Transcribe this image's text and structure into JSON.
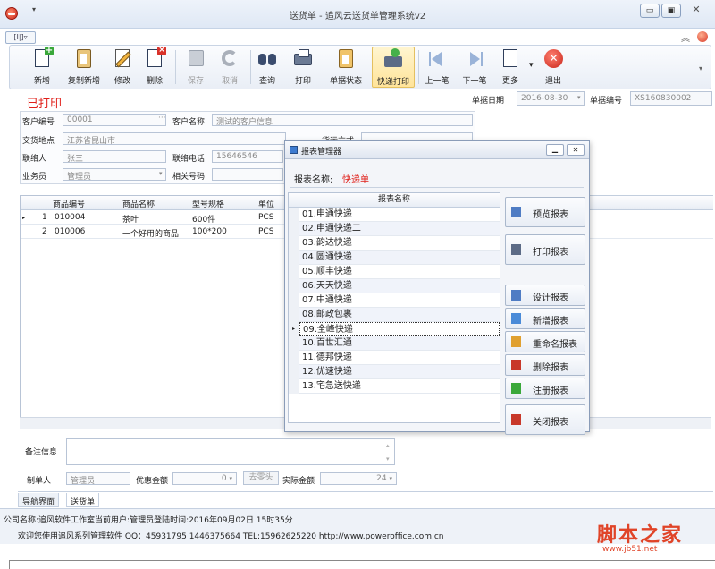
{
  "window": {
    "title": "送货单 - 追风云送货单管理系统v2",
    "min": "▭",
    "max": "▣",
    "close": "✕"
  },
  "ribbon_tab_toggle": "[I|]▿",
  "toolbar": {
    "buttons": [
      {
        "label": "新增",
        "icon": "new-doc-icon"
      },
      {
        "label": "复制新增",
        "icon": "copy-icon"
      },
      {
        "label": "修改",
        "icon": "edit-icon"
      },
      {
        "label": "删除",
        "icon": "delete-icon"
      },
      {
        "label": "保存",
        "icon": "save-icon",
        "disabled": true
      },
      {
        "label": "取消",
        "icon": "cancel-icon",
        "disabled": true
      },
      {
        "label": "查询",
        "icon": "binoculars-icon"
      },
      {
        "label": "打印",
        "icon": "print-icon"
      },
      {
        "label": "单据状态",
        "icon": "status-icon"
      },
      {
        "label": "快递打印",
        "icon": "express-print-icon",
        "active": true
      },
      {
        "label": "上一笔",
        "icon": "previous-icon"
      },
      {
        "label": "下一笔",
        "icon": "next-icon"
      },
      {
        "label": "更多",
        "icon": "more-icon"
      },
      {
        "label": "退出",
        "icon": "exit-icon"
      }
    ]
  },
  "doc": {
    "status": "已打印",
    "date_label": "单据日期",
    "date": "2016-08-30",
    "no_label": "单据编号",
    "no": "XS160830002"
  },
  "form": {
    "customer_no_label": "客户编号",
    "customer_no": "00001",
    "customer_name_label": "客户名称",
    "customer_name": "测试的客户信息",
    "delivery_label": "交货地点",
    "delivery": "江苏省昆山市",
    "contact_label": "联络人",
    "contact": "张三",
    "phone_label": "联络电话",
    "phone": "15646546",
    "salesman_label": "业务员",
    "salesman": "管理员",
    "related_no_label": "相关号码",
    "ship_label": "货运方式"
  },
  "grid": {
    "headers": [
      "商品编号",
      "商品名称",
      "型号规格",
      "单位"
    ],
    "rows": [
      {
        "idx": "1",
        "code": "010004",
        "name": "茶叶",
        "spec": "600件",
        "unit": "PCS"
      },
      {
        "idx": "2",
        "code": "010006",
        "name": "一个好用的商品",
        "spec": "100*200",
        "unit": "PCS"
      }
    ]
  },
  "footer": {
    "memo_label": "备注信息",
    "maker_label": "制单人",
    "maker": "管理员",
    "discount_label": "优惠金额",
    "discount": "0",
    "round_btn": "去零头",
    "actual_label": "实际金额",
    "actual": "24"
  },
  "tabs": [
    "导航界面",
    "送货单"
  ],
  "statusbar": {
    "line1": "公司名称:追风软件工作室当前用户:管理员登陆时间:2016年09月02日 15时35分",
    "line2": "欢迎您使用追风系列管理软件 QQ：45931795 1446375664 TEL:15962625220 http://www.poweroffice.com.cn"
  },
  "watermark": {
    "text": "脚本之家",
    "url": "www.jb51.net"
  },
  "dialog": {
    "title": "报表管理器",
    "min": "▁",
    "close": "✕",
    "report_label": "报表名称:",
    "report_value": "快递单",
    "list_header": "报表名称",
    "reports": [
      "01.申通快递",
      "02.申通快递二",
      "03.韵达快递",
      "04.圆通快递",
      "05.顺丰快递",
      "06.天天快递",
      "07.中通快递",
      "08.邮政包裹",
      "09.全峰快递",
      "10.百世汇通",
      "11.德邦快递",
      "12.优速快递",
      "13.宅急送快递"
    ],
    "selected_index": 8,
    "buttons": [
      {
        "label": "预览报表",
        "icon": "preview-icon",
        "color": "#4f7cc4"
      },
      {
        "label": "打印报表",
        "icon": "print-icon",
        "color": "#5c6b86"
      },
      {
        "label": "设计报表",
        "icon": "design-icon",
        "color": "#4f7cc4"
      },
      {
        "label": "新增报表",
        "icon": "add-report-icon",
        "color": "#4a8bd8"
      },
      {
        "label": "重命名报表",
        "icon": "rename-icon",
        "color": "#e0a030"
      },
      {
        "label": "删除报表",
        "icon": "delete-report-icon",
        "color": "#c8382a"
      },
      {
        "label": "注册报表",
        "icon": "register-icon",
        "color": "#3aa83a"
      },
      {
        "label": "关闭报表",
        "icon": "close-report-icon",
        "color": "#c8382a"
      }
    ]
  }
}
